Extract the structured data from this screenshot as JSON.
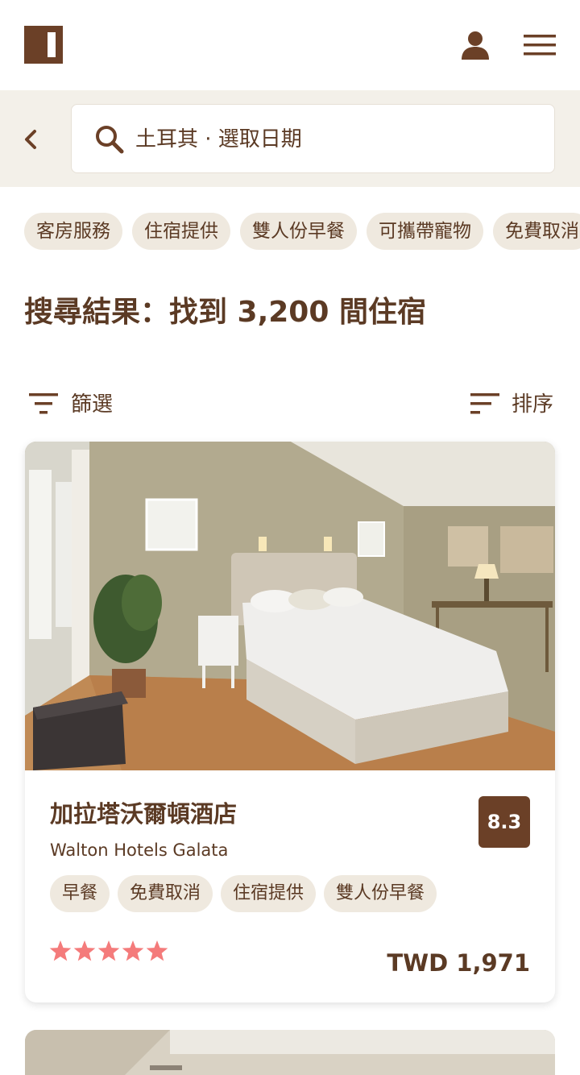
{
  "search": {
    "text": "土耳其 · 選取日期"
  },
  "filters": {
    "chips": [
      "客房服務",
      "住宿提供",
      "雙人份早餐",
      "可攜帶寵物",
      "免費取消"
    ]
  },
  "results": {
    "title": "搜尋結果：找到 3,200 間住宿",
    "filter_label": "篩選",
    "sort_label": "排序"
  },
  "hotels": [
    {
      "name": "加拉塔沃爾頓酒店",
      "name_en": "Walton Hotels Galata",
      "score": "8.3",
      "tags": [
        "早餐",
        "免費取消",
        "住宿提供",
        "雙人份早餐"
      ],
      "stars": 5,
      "price": "TWD 1,971"
    }
  ],
  "colors": {
    "brand": "#6b4027",
    "text": "#5b3a24",
    "chip_bg": "#efe9df",
    "search_band": "#f3f0e9",
    "star": "#f47b7b"
  },
  "icons": {
    "logo": "brand-logo",
    "user": "user-icon",
    "menu": "hamburger-menu-icon",
    "back": "chevron-left-icon",
    "search": "search-icon",
    "filter": "filter-icon",
    "sort": "sort-icon",
    "star": "star-icon"
  }
}
